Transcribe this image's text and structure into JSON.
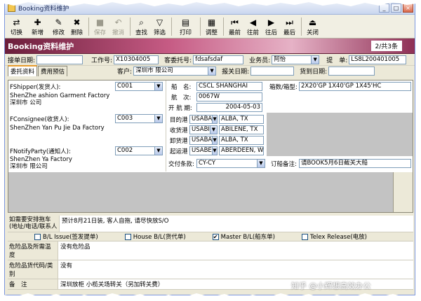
{
  "window": {
    "title": "Booking资料维护"
  },
  "toolbar": [
    {
      "label": "切换",
      "icon": "switch-icon",
      "glyph": "⇄",
      "disabled": false
    },
    {
      "label": "新增",
      "icon": "new-icon",
      "glyph": "✚",
      "disabled": false,
      "dropdown": true
    },
    {
      "label": "修改",
      "icon": "edit-icon",
      "glyph": "✎",
      "disabled": false
    },
    {
      "label": "删除",
      "icon": "delete-icon",
      "glyph": "✖",
      "disabled": false
    },
    {
      "label": "保存",
      "icon": "save-icon",
      "glyph": "■",
      "disabled": true
    },
    {
      "label": "撤消",
      "icon": "undo-icon",
      "glyph": "↶",
      "disabled": true
    },
    {
      "label": "查找",
      "icon": "find-icon",
      "glyph": "⌕",
      "disabled": false
    },
    {
      "label": "筛选",
      "icon": "filter-icon",
      "glyph": "▽",
      "disabled": false
    },
    {
      "label": "打印",
      "icon": "print-icon",
      "glyph": "▤",
      "disabled": false,
      "dropdown": true
    },
    {
      "label": "调整",
      "icon": "adjust-icon",
      "glyph": "▦",
      "disabled": false
    },
    {
      "label": "最前",
      "icon": "first-icon",
      "glyph": "⏮",
      "disabled": false
    },
    {
      "label": "往前",
      "icon": "prev-icon",
      "glyph": "◀",
      "disabled": false
    },
    {
      "label": "往后",
      "icon": "next-icon",
      "glyph": "▶",
      "disabled": false
    },
    {
      "label": "最后",
      "icon": "last-icon",
      "glyph": "⏭",
      "disabled": false
    },
    {
      "label": "关闭",
      "icon": "close-icon",
      "glyph": "⏏",
      "disabled": false
    }
  ],
  "banner": {
    "title": "Booking资料维护",
    "record": "2/共3条"
  },
  "header": {
    "booking_date_label": "接单日期:",
    "booking_date": "",
    "job_no_label": "工作号:",
    "job_no": "X10304005",
    "consign_no_label": "客委托号:",
    "consign_no": "fdsafsdaf",
    "sales_label": "业务员:",
    "sales": "阿怡",
    "bl_label": "提　单:",
    "bl_no": "LS8L200401005"
  },
  "tabs": [
    {
      "label": "委托资料"
    },
    {
      "label": "费用预估"
    }
  ],
  "tabrow": {
    "customer_label": "客户:",
    "customer": "深圳市        限公司",
    "customs_date_label": "报关日期:",
    "customs_date": "",
    "arrive_date_label": "货到日期:",
    "arrive_date": ""
  },
  "shipper": {
    "label": "FShipper(发货人):",
    "code": "C001",
    "text1": "ShenZhe              ashion Garment Factory",
    "text2": "深圳市          公司"
  },
  "consignee": {
    "label": "FConsignee(收货人):",
    "code": "C003",
    "text1": "ShenZhen Yan Pu Jie Da Factory"
  },
  "notify": {
    "label": "FNotifyParty(通知人):",
    "code": "C002",
    "text1": "ShenZhen Ya              Factory",
    "text2": "深圳市            限公司"
  },
  "vessel": {
    "ship_label": "船　名:",
    "ship": "CSCL SHANGHAI",
    "voyage_label": "航　次:",
    "voyage": "0067W",
    "sail_label": "开 航 期:",
    "sail_date": "2004-05-03",
    "box_label": "箱数/箱型:",
    "box": "2X20'GP 1X40'GP 1X45'HC"
  },
  "ports": [
    {
      "label": "目的港",
      "code": "USABA",
      "name": "ALBA, TX"
    },
    {
      "label": "收货港",
      "code": "USABI",
      "name": "ABILENE, TX"
    },
    {
      "label": "卸货港",
      "code": "USABA",
      "name": "ALBA, TX"
    },
    {
      "label": "起运港",
      "code": "USABE",
      "name": "ABERDEEN, WA"
    }
  ],
  "terms": {
    "label": "交付条款:",
    "value": "CY-CY",
    "order_label": "订船备注:",
    "order_note": "请BOOK5月6日截关大船"
  },
  "trailer": {
    "label": "如需要安排拖车(地址/电话/联系人",
    "value": "预计8月21日装, 客人自拖, 请尽快放S/O"
  },
  "checks": [
    {
      "label": "B/L Issue(签发提单)",
      "checked": false
    },
    {
      "label": "House B/L(货代单)",
      "checked": false
    },
    {
      "label": "Master B/L(船东单)",
      "checked": true
    },
    {
      "label": "Telex Release(电放)",
      "checked": false
    }
  ],
  "danger": {
    "label": "危险品及所需温度",
    "value": "没有危险品"
  },
  "danger_class": {
    "label": "危险品货代码/类别",
    "value": "没有"
  },
  "remark": {
    "label": "备　注",
    "value": "深圳放柜 小榄关场转关（另加转关费）"
  },
  "watermark": "知乎 @小辉想高效办公"
}
